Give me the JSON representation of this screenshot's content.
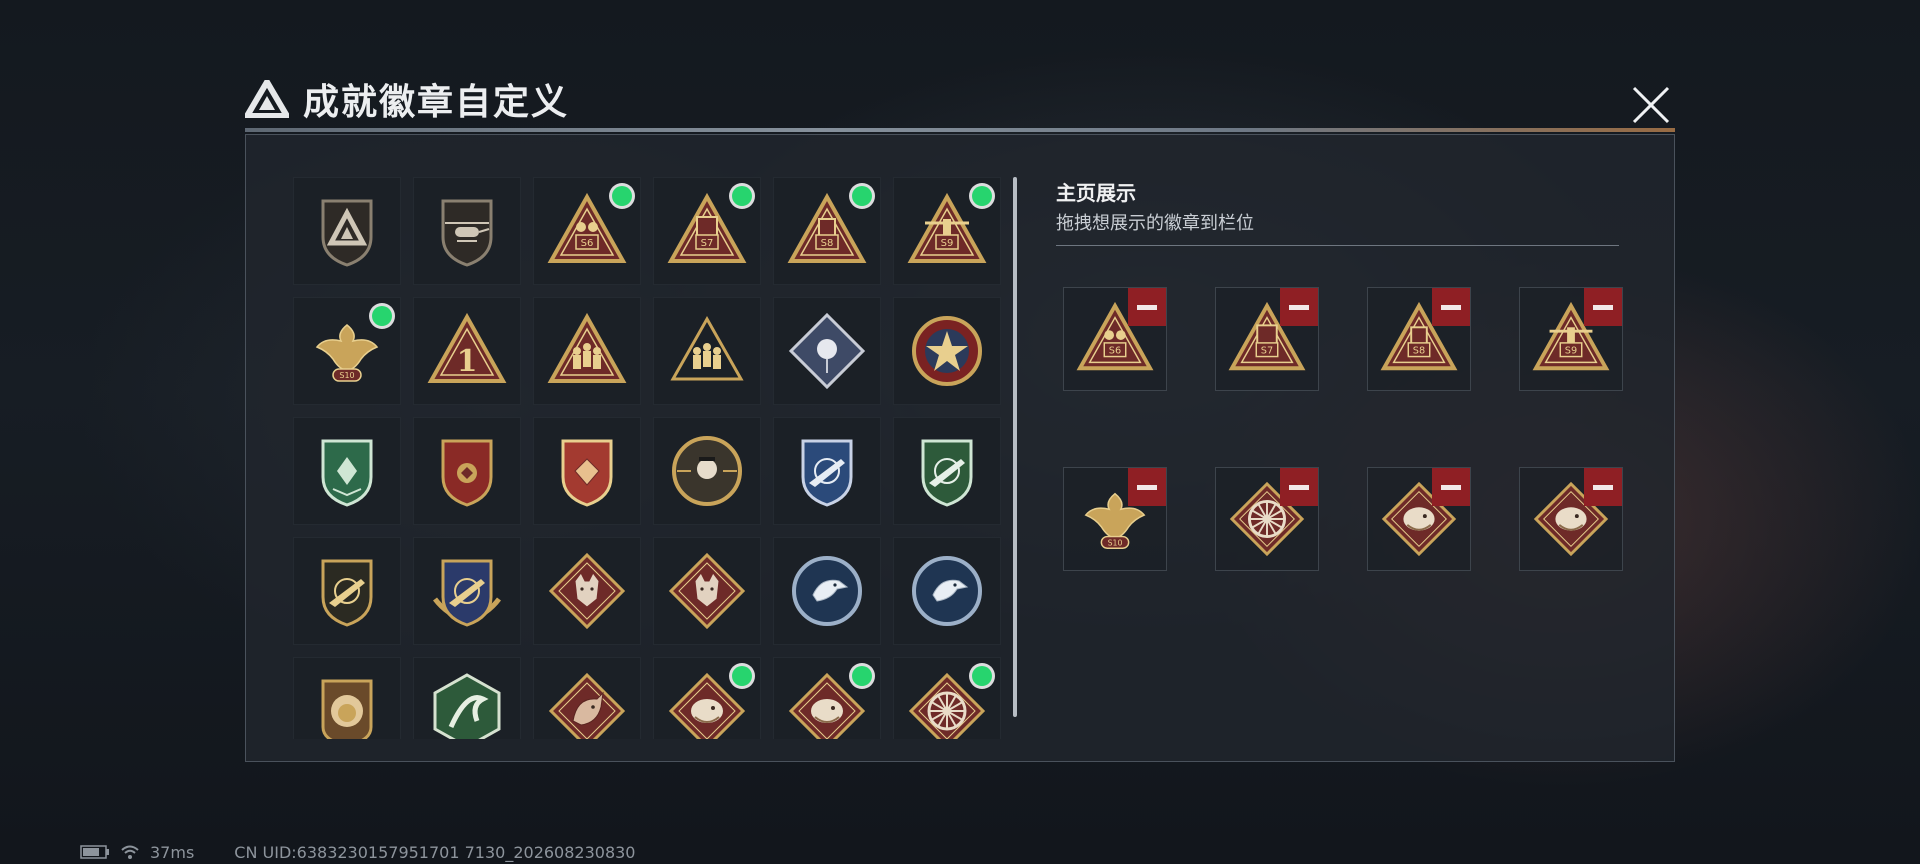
{
  "dialog": {
    "title": "成就徽章自定义",
    "logo_icon": "delta-logo-icon",
    "close_icon": "close-icon"
  },
  "badges": [
    {
      "icon": "delta-shield-badge",
      "new": false
    },
    {
      "icon": "helicopter-shield-badge",
      "new": false
    },
    {
      "icon": "s6-season-badge",
      "new": true
    },
    {
      "icon": "s7-season-badge",
      "new": true
    },
    {
      "icon": "s8-season-badge",
      "new": true
    },
    {
      "icon": "s9-season-badge",
      "new": true
    },
    {
      "icon": "s10-eagle-badge",
      "new": true
    },
    {
      "icon": "rank-1-triangle-badge",
      "new": false
    },
    {
      "icon": "squad-triangle-badge",
      "new": false
    },
    {
      "icon": "squad-triangle-badge-2",
      "new": false
    },
    {
      "icon": "rose-diamond-badge",
      "new": false
    },
    {
      "icon": "star-roundel-badge",
      "new": false
    },
    {
      "icon": "green-shield-badge",
      "new": false
    },
    {
      "icon": "gold-red-shield-badge",
      "new": false
    },
    {
      "icon": "red-gold-shield-badge",
      "new": false
    },
    {
      "icon": "skull-crosshair-badge",
      "new": false
    },
    {
      "icon": "blue-rifle-shield-badge",
      "new": false
    },
    {
      "icon": "green-rifle-shield-badge",
      "new": false
    },
    {
      "icon": "rifle-crosshair-badge",
      "new": false
    },
    {
      "icon": "gold-winged-shield-badge",
      "new": false
    },
    {
      "icon": "wolf-diamond-badge",
      "new": false
    },
    {
      "icon": "wolf-diamond-badge-2",
      "new": false
    },
    {
      "icon": "eagle-roundel-badge",
      "new": false
    },
    {
      "icon": "eagle-roundel-badge-2",
      "new": false
    },
    {
      "icon": "lion-shield-badge",
      "new": false
    },
    {
      "icon": "serpent-hexagon-badge",
      "new": false
    },
    {
      "icon": "dragon-diamond-badge",
      "new": false
    },
    {
      "icon": "serpent-diamond-badge",
      "new": true
    },
    {
      "icon": "serpent-diamond-badge-2",
      "new": true
    },
    {
      "icon": "wheel-diamond-badge",
      "new": true
    }
  ],
  "showcase": {
    "title": "主页展示",
    "subtitle": "拖拽想展示的徽章到栏位",
    "slots": [
      {
        "icon": "s6-season-badge"
      },
      {
        "icon": "s7-season-badge"
      },
      {
        "icon": "s8-season-badge"
      },
      {
        "icon": "s9-season-badge"
      },
      {
        "icon": "s10-eagle-badge"
      },
      {
        "icon": "wheel-diamond-badge"
      },
      {
        "icon": "serpent-diamond-badge"
      },
      {
        "icon": "serpent-diamond-badge-2"
      }
    ],
    "remove_icon": "minus-icon"
  },
  "status": {
    "ping": "37ms",
    "uid": "CN UID:6383230157951701 7130_202608230830"
  },
  "colors": {
    "gold": "#c9a45a",
    "gold_light": "#e8cf8e",
    "maroon": "#6e2a28",
    "new_dot": "#27d46e",
    "remove_red": "#8f1f24"
  }
}
